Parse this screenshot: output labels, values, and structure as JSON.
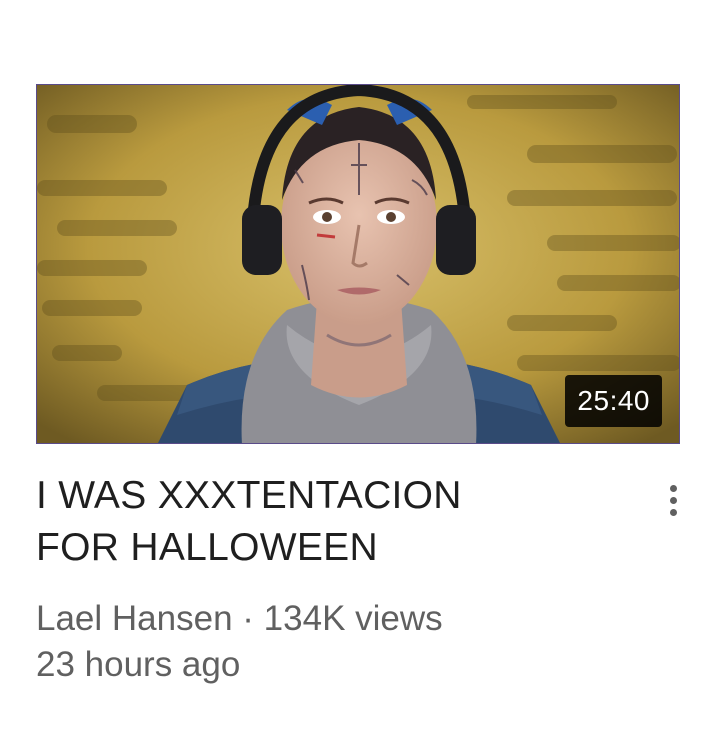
{
  "video": {
    "duration": "25:40",
    "title_lines": [
      "I WAS XXXTENTACION",
      "FOR HALLOWEEN"
    ],
    "channel": "Lael Hansen",
    "separator": "·",
    "views": "134K views",
    "uploaded": "23 hours ago"
  },
  "icons": {
    "menu": "more-vertical-icon"
  },
  "colors": {
    "background": "#ffffff",
    "title": "#1f1f1f",
    "meta": "#606060",
    "badge_bg": "#000000",
    "badge_text": "#ffffff"
  }
}
